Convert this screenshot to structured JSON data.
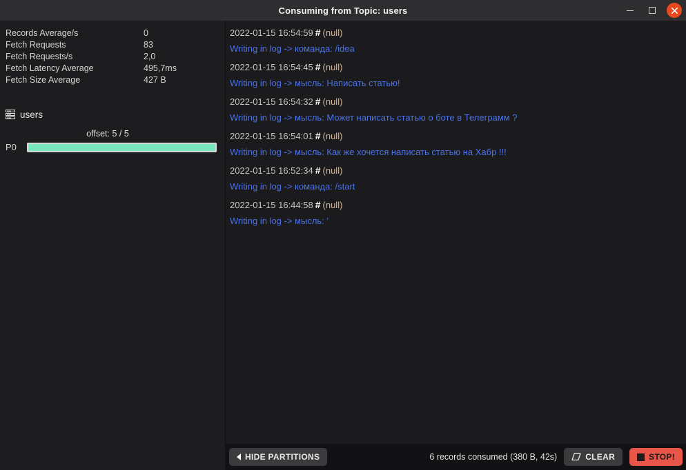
{
  "window": {
    "title": "Consuming from Topic: users",
    "controls": {
      "minimize": "minimize-icon",
      "maximize": "maximize-icon",
      "close": "close-icon"
    }
  },
  "sidebar": {
    "stats": [
      {
        "label": "Records Average/s",
        "value": "0"
      },
      {
        "label": "Fetch Requests",
        "value": "83"
      },
      {
        "label": "Fetch Requests/s",
        "value": "2,0"
      },
      {
        "label": "Fetch Latency Average",
        "value": "495,7ms"
      },
      {
        "label": "Fetch Size Average",
        "value": "427 B"
      }
    ],
    "topic": {
      "icon": "server-stack-icon",
      "name": "users"
    },
    "partitions": {
      "offset_label": "offset: 5 / 5",
      "items": [
        {
          "name": "P0",
          "progress_percent": 100
        }
      ]
    }
  },
  "records": [
    {
      "timestamp": "2022-01-15 16:54:59",
      "separator": "#",
      "key": "(null)",
      "message": "Writing in log -> команда: /idea"
    },
    {
      "timestamp": "2022-01-15 16:54:45",
      "separator": "#",
      "key": "(null)",
      "message": "Writing in log -> мысль: Написать статью!"
    },
    {
      "timestamp": "2022-01-15 16:54:32",
      "separator": "#",
      "key": "(null)",
      "message": "Writing in log -> мысль: Может написать статью о боте в Телеграмм ?"
    },
    {
      "timestamp": "2022-01-15 16:54:01",
      "separator": "#",
      "key": "(null)",
      "message": "Writing in log -> мысль: Как же хочется написать статью на Хабр !!!"
    },
    {
      "timestamp": "2022-01-15 16:52:34",
      "separator": "#",
      "key": "(null)",
      "message": "Writing in log -> команда: /start"
    },
    {
      "timestamp": "2022-01-15 16:44:58",
      "separator": "#",
      "key": "(null)",
      "message": "Writing in log -> мысль: '"
    }
  ],
  "footer": {
    "hide_partitions_label": "HIDE PARTITIONS",
    "status": "6 records consumed (380 B, 42s)",
    "clear_label": "CLEAR",
    "stop_label": "STOP!"
  },
  "colors": {
    "accent_red": "#e8564a",
    "close_red": "#e8491f",
    "progress_green": "#77e8bb",
    "message_blue": "#4b72e8",
    "key_tan": "#d6b89a",
    "background": "#1b1b1d",
    "titlebar": "#2e2e30",
    "footer": "#121214"
  }
}
